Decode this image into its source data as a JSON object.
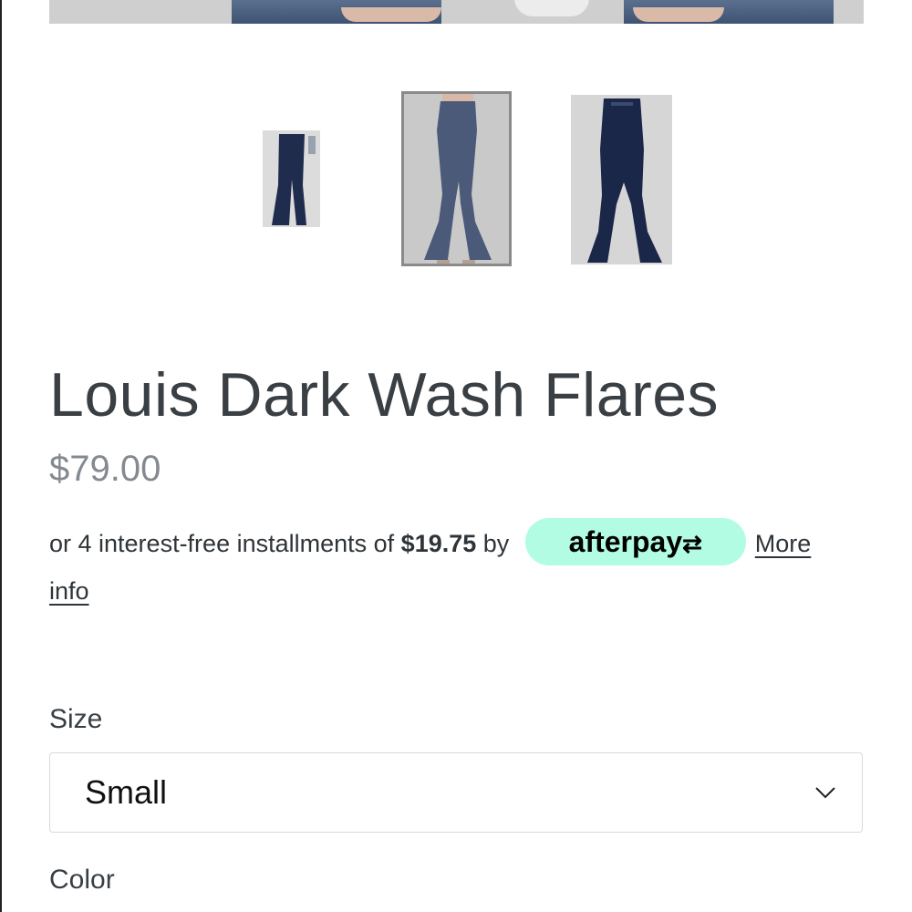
{
  "product": {
    "title": "Louis Dark Wash Flares",
    "price": "$79.00"
  },
  "afterpay": {
    "prefix": "or 4 interest-free installments of ",
    "amount": "$19.75",
    "by": " by ",
    "brand": "afterpay",
    "more_info": "More info",
    "badge_color": "#b2fce4"
  },
  "gallery": {
    "thumbnails": [
      {
        "icon": "jeans-thumbnail",
        "selected": false
      },
      {
        "icon": "jeans-thumbnail",
        "selected": true
      },
      {
        "icon": "jeans-thumbnail",
        "selected": false
      }
    ]
  },
  "options": {
    "size_label": "Size",
    "size_value": "Small",
    "color_label": "Color"
  }
}
